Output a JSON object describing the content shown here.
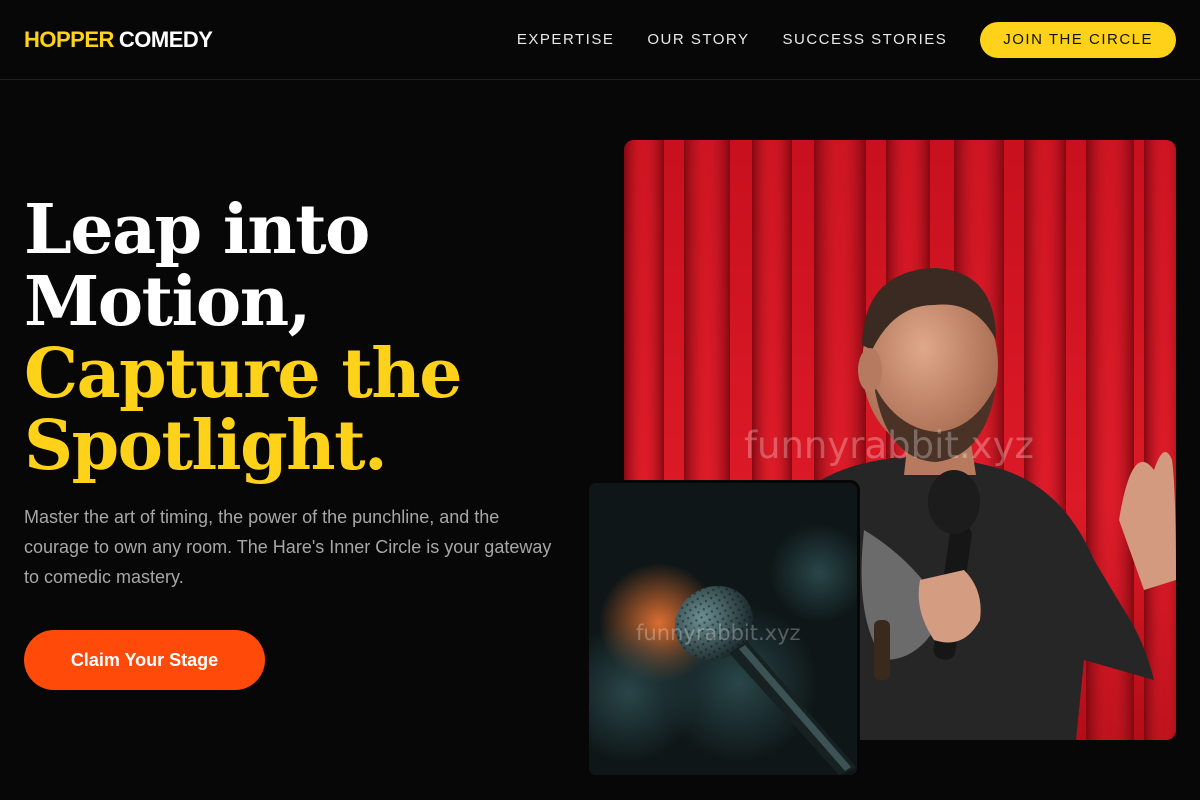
{
  "header": {
    "logo_part1": "HOPPER",
    "logo_part2": "COMEDY",
    "nav": [
      "EXPERTISE",
      "OUR STORY",
      "SUCCESS STORIES"
    ],
    "join_label": "JOIN THE CIRCLE"
  },
  "hero": {
    "headline_line1": "Leap into",
    "headline_line2": "Motion,",
    "headline_line3": "Capture the",
    "headline_line4": "Spotlight.",
    "subtext": "Master the art of timing, the power of the punchline, and the courage to own any room. The Hare's Inner Circle is your gateway to comedic mastery.",
    "cta_label": "Claim Your Stage"
  },
  "images": {
    "main_photo_icon": "comedian-on-stage-photo",
    "secondary_photo_icon": "microphone-photo",
    "watermark_main": "funnyrabbit.xyz",
    "watermark_small": "funnyrabbit.xyz"
  },
  "colors": {
    "accent": "#FFD21A",
    "cta": "#FF4A0A",
    "background": "#070707"
  }
}
